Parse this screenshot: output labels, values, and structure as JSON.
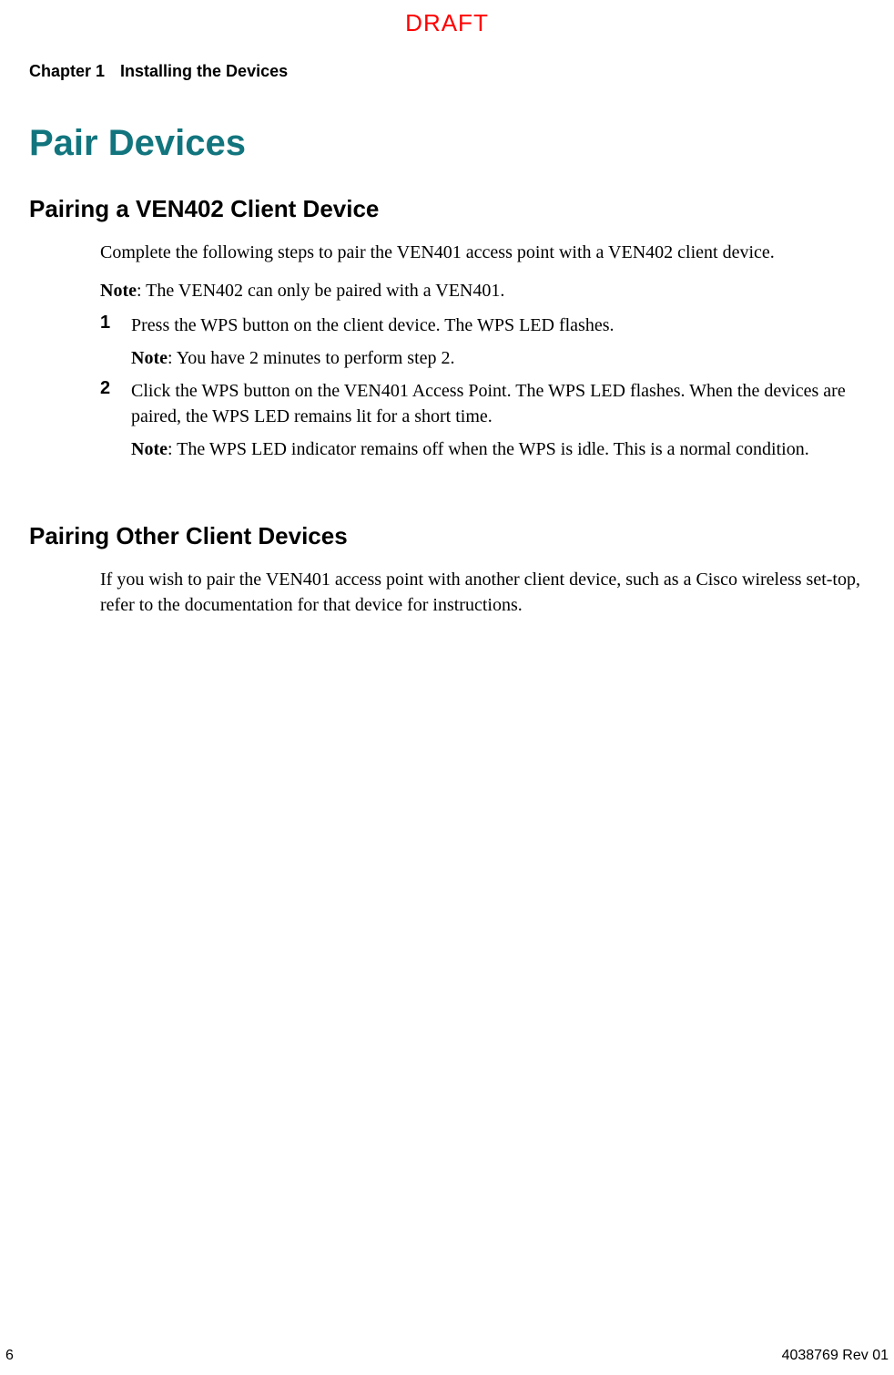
{
  "watermark": "DRAFT",
  "chapter": {
    "label": "Chapter 1",
    "title": "Installing the Devices"
  },
  "page_title": "Pair Devices",
  "section1": {
    "heading": "Pairing a VEN402 Client Device",
    "intro": "Complete the following steps to pair the VEN401 access point with a VEN402 client device.",
    "note_label": "Note",
    "note_text": ": The VEN402 can only be paired with a VEN401.",
    "steps": [
      {
        "number": "1",
        "text": "Press the WPS button on the client device. The WPS LED flashes.",
        "sub_note_label": "Note",
        "sub_note_text": ": You have 2 minutes to perform step 2."
      },
      {
        "number": "2",
        "text": "Click the WPS button on the VEN401 Access Point. The WPS LED flashes. When the devices are paired, the WPS LED remains lit for a short time.",
        "sub_note_label": "Note",
        "sub_note_text": ": The WPS LED indicator remains off when the WPS is idle. This is a normal condition."
      }
    ]
  },
  "section2": {
    "heading": "Pairing Other Client Devices",
    "body": "If you wish to pair the VEN401 access point with another client device, such as a Cisco wireless set-top, refer to the documentation for that device for instructions."
  },
  "footer": {
    "page_number": "6",
    "doc_id": "4038769 Rev 01"
  }
}
